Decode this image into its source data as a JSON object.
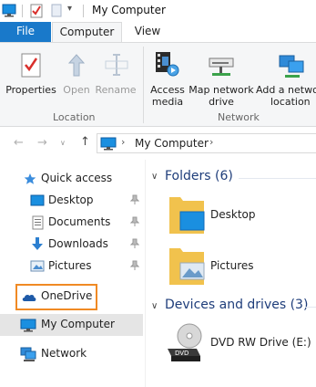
{
  "window": {
    "title": "My Computer"
  },
  "ribbon": {
    "tabs": {
      "file": "File",
      "computer": "Computer",
      "view": "View"
    },
    "buttons": {
      "properties": "Properties",
      "open": "Open",
      "rename": "Rename",
      "access_media_1": "Access",
      "access_media_2": "media",
      "map_drive_1": "Map network",
      "map_drive_2": "drive",
      "add_location_1": "Add a network",
      "add_location_2": "location"
    },
    "groups": {
      "location": "Location",
      "network": "Network"
    }
  },
  "address": {
    "path": "My Computer"
  },
  "nav": {
    "quick_access": "Quick access",
    "desktop": "Desktop",
    "documents": "Documents",
    "downloads": "Downloads",
    "pictures": "Pictures",
    "onedrive": "OneDrive",
    "my_computer": "My Computer",
    "network": "Network"
  },
  "content": {
    "folders_header": "Folders (6)",
    "folders": [
      "Desktop",
      "Pictures"
    ],
    "devices_header": "Devices and drives (3)",
    "drives": [
      "DVD RW Drive (E:)"
    ]
  },
  "colors": {
    "accent": "#1979ca",
    "highlight_border": "#f08a24",
    "selection": "#e5e5e5"
  }
}
